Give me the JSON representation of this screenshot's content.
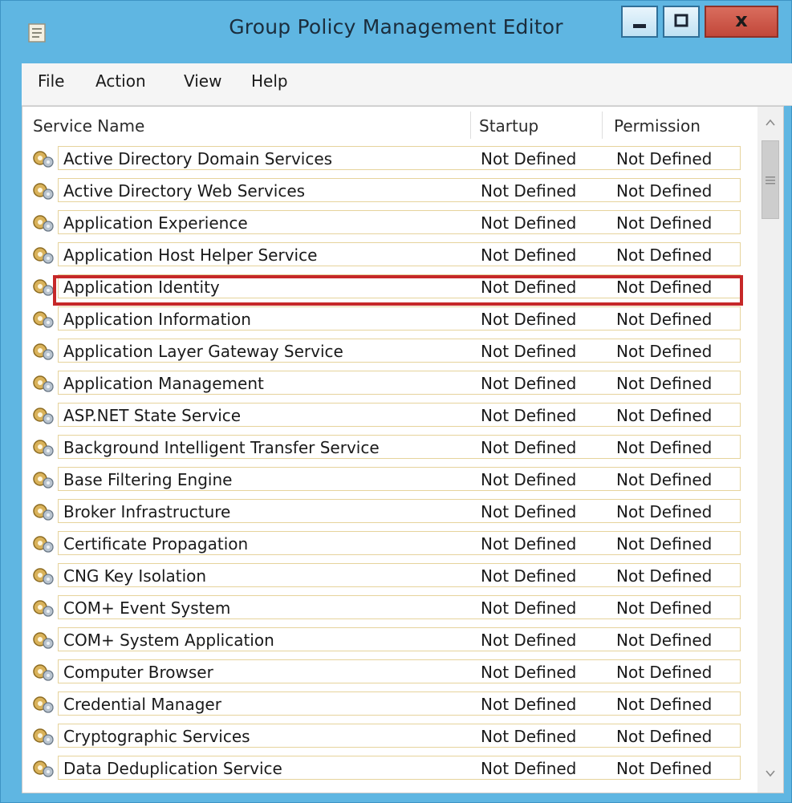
{
  "window": {
    "title": "Group Policy Management Editor",
    "close_glyph": "x"
  },
  "menu": [
    "File",
    "Action",
    "View",
    "Help"
  ],
  "columns": {
    "name": "Service Name",
    "startup": "Startup",
    "permission": "Permission"
  },
  "services": [
    {
      "name": "Active Directory Domain Services",
      "startup": "Not Defined",
      "permission": "Not Defined"
    },
    {
      "name": "Active Directory Web Services",
      "startup": "Not Defined",
      "permission": "Not Defined"
    },
    {
      "name": "Application Experience",
      "startup": "Not Defined",
      "permission": "Not Defined"
    },
    {
      "name": "Application Host Helper Service",
      "startup": "Not Defined",
      "permission": "Not Defined"
    },
    {
      "name": "Application Identity",
      "startup": "Not Defined",
      "permission": "Not Defined"
    },
    {
      "name": "Application Information",
      "startup": "Not Defined",
      "permission": "Not Defined"
    },
    {
      "name": "Application Layer Gateway Service",
      "startup": "Not Defined",
      "permission": "Not Defined"
    },
    {
      "name": "Application Management",
      "startup": "Not Defined",
      "permission": "Not Defined"
    },
    {
      "name": "ASP.NET State Service",
      "startup": "Not Defined",
      "permission": "Not Defined"
    },
    {
      "name": "Background Intelligent Transfer Service",
      "startup": "Not Defined",
      "permission": "Not Defined"
    },
    {
      "name": "Base Filtering Engine",
      "startup": "Not Defined",
      "permission": "Not Defined"
    },
    {
      "name": "Broker Infrastructure",
      "startup": "Not Defined",
      "permission": "Not Defined"
    },
    {
      "name": "Certificate Propagation",
      "startup": "Not Defined",
      "permission": "Not Defined"
    },
    {
      "name": "CNG Key Isolation",
      "startup": "Not Defined",
      "permission": "Not Defined"
    },
    {
      "name": "COM+ Event System",
      "startup": "Not Defined",
      "permission": "Not Defined"
    },
    {
      "name": "COM+ System Application",
      "startup": "Not Defined",
      "permission": "Not Defined"
    },
    {
      "name": "Computer Browser",
      "startup": "Not Defined",
      "permission": "Not Defined"
    },
    {
      "name": "Credential Manager",
      "startup": "Not Defined",
      "permission": "Not Defined"
    },
    {
      "name": "Cryptographic Services",
      "startup": "Not Defined",
      "permission": "Not Defined"
    },
    {
      "name": "Data Deduplication Service",
      "startup": "Not Defined",
      "permission": "Not Defined"
    }
  ],
  "highlighted_service": "Application Identity",
  "colors": {
    "window_frame": "#5fb6e2",
    "highlight_box": "#c62828",
    "row_border": "#e6d39c",
    "close_button": "#c2473a"
  },
  "icons": {
    "app": "policy-document-icon",
    "row": "service-gear-icon",
    "scroll_up": "chevron-up-icon",
    "scroll_down": "chevron-down-icon"
  }
}
